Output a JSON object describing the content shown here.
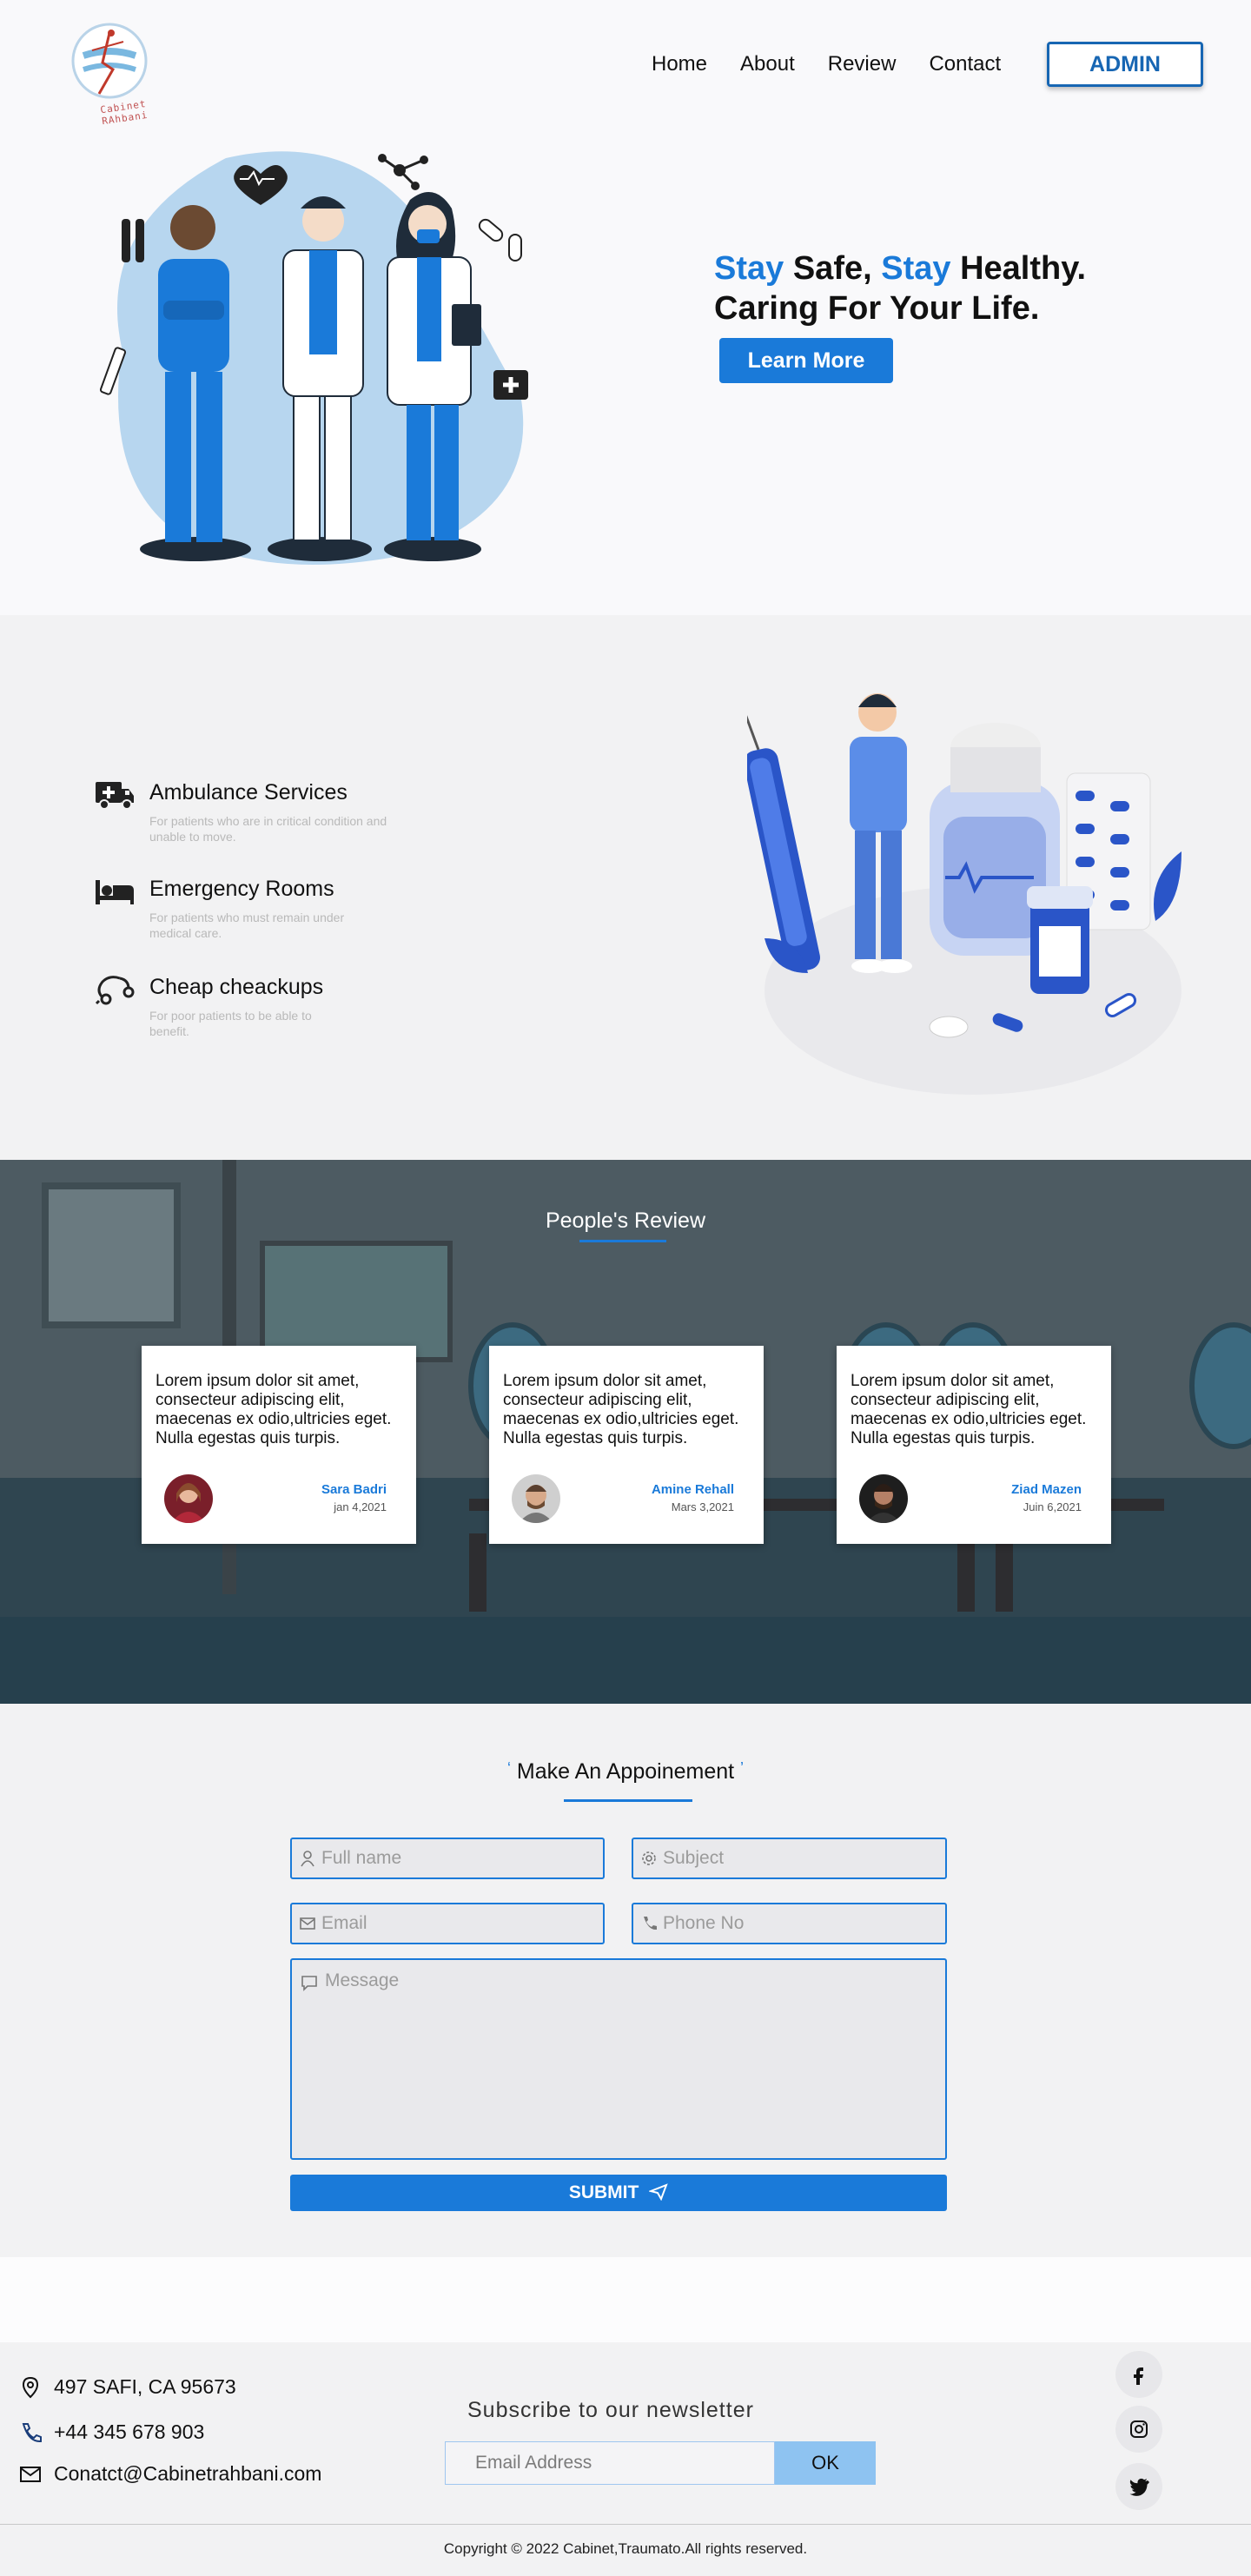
{
  "header": {
    "logo_text": "Cabinet RAhbani",
    "nav": [
      "Home",
      "About",
      "Review",
      "Contact"
    ],
    "admin_label": "ADMIN"
  },
  "hero": {
    "title_word1": "Stay",
    "title_word2": " Safe, ",
    "title_word3": "Stay",
    "title_word4": " Healthy.",
    "title_line2": "Caring For Your Life.",
    "cta_label": "Learn More"
  },
  "services": [
    {
      "title": "Ambulance Services",
      "desc": "For patients who are in critical condition and unable to move.",
      "icon": "ambulance-icon"
    },
    {
      "title": "Emergency Rooms",
      "desc": "For patients who must remain under medical care.",
      "icon": "bed-icon"
    },
    {
      "title": "Cheap cheackups",
      "desc": "For poor patients to be able to benefit.",
      "icon": "stethoscope-icon"
    }
  ],
  "reviews": {
    "title": "People's Review",
    "cards": [
      {
        "text": "Lorem ipsum dolor sit amet, consecteur adipiscing elit, maecenas ex odio,ultricies eget. Nulla egestas quis turpis.",
        "name": "Sara Badri",
        "date": "jan 4,2021"
      },
      {
        "text": "Lorem ipsum dolor sit amet, consecteur adipiscing elit, maecenas ex odio,ultricies eget. Nulla egestas quis turpis.",
        "name": "Amine Rehall",
        "date": "Mars 3,2021"
      },
      {
        "text": "Lorem ipsum dolor sit amet, consecteur adipiscing elit, maecenas ex odio,ultricies eget. Nulla egestas quis turpis.",
        "name": "Ziad Mazen",
        "date": "Juin 6,2021"
      }
    ]
  },
  "appointment": {
    "title": "Make An Appoinement",
    "fullname_placeholder": "Full name",
    "subject_placeholder": "Subject",
    "email_placeholder": "Email",
    "phone_placeholder": "Phone No",
    "message_placeholder": "Message",
    "submit_label": "SUBMIT"
  },
  "footer": {
    "address": "497  SAFI, CA 95673",
    "phone": "+44 345 678 903",
    "email": "Conatct@Cabinetrahbani.com",
    "newsletter_title": "Subscribe to our newsletter",
    "newsletter_placeholder": "Email Address",
    "newsletter_button": "OK",
    "copyright": "Copyright © 2022 Cabinet,Traumato.All rights reserved."
  },
  "colors": {
    "accent": "#1a7ad9",
    "admin_border": "#1766b3",
    "reviews_bg": "#4a5a63",
    "newsletter_button": "#8ec3f1"
  }
}
